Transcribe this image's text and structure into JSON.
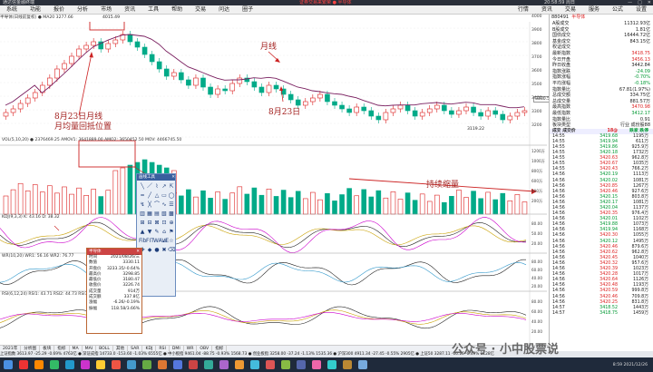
{
  "titlebar": {
    "left": "通达信金融终端",
    "center": "证券交易来繁荣 ● 半导体",
    "time": "20:58:59 周日"
  },
  "menu": [
    "系统",
    "功能",
    "报价",
    "分析",
    "市场",
    "资讯",
    "工具",
    "帮助",
    "交易",
    "问达",
    "圈子"
  ],
  "menu_right": [
    "行情",
    "资讯",
    "交易",
    "服务",
    "公式",
    "设置"
  ],
  "infobar": "半导体(日线前复权) ● MA20 3277.66",
  "kline_labels": {
    "top_price": "4015.49",
    "low_price": "3119.22",
    "right_scale": "3330.57"
  },
  "price_scale": [
    "4000",
    "3900",
    "3800",
    "3700",
    "3600",
    "3500",
    "3400",
    "3300",
    "3200",
    "3100"
  ],
  "annotations": {
    "month_line": "月线",
    "aug23_a": "8月23日月线",
    "aug23_b": "月均量回抵位置",
    "aug23_c": "8月23日",
    "shrink": "持续缩量"
  },
  "vol_label": "VOL(5,10,20) ● 2376469.25 AMOV1: 3641889.00 AMO2: 3650452.50 MOV: 4466745.50",
  "vol_scale": [
    "1200万",
    "1000万",
    "800万",
    "600万",
    "400万",
    "200万",
    "100万"
  ],
  "kdj_label": "KDJ(9,3,3) K: 43.16 D: 38.32",
  "kdj_scale": [
    "80.00",
    "50.00",
    "20.00"
  ],
  "wr_label": "WR(10,20) WR1: 56.16 WR2: 76.77",
  "wr_scale": [
    "80.00",
    "60.00",
    "40.00",
    "20.00"
  ],
  "rsi_label": "RSI(6,12,24) RSI1: 43.71 RSI2: 44.73 RSI3: 45.90",
  "rsi_scale": [
    "80.00",
    "60.00",
    "40.00",
    "20.00"
  ],
  "right_panel": {
    "code": "880491",
    "name": "半导体",
    "rows": [
      {
        "k": "A股成交",
        "v": "11312.93亿",
        "c": "blk"
      },
      {
        "k": "B股成交",
        "v": "1.81亿",
        "c": "blk"
      },
      {
        "k": "国债成交",
        "v": "16444.72亿",
        "c": "blk"
      },
      {
        "k": "基金成交",
        "v": "843.15亿",
        "c": "blk"
      },
      {
        "k": "权证成交",
        "v": "",
        "c": "blk"
      },
      {
        "k": "最新指数",
        "v": "3418.75",
        "c": "red"
      },
      {
        "k": "今日开盘",
        "v": "3456.13",
        "c": "red"
      },
      {
        "k": "昨日收盘",
        "v": "3442.84",
        "c": "blk"
      },
      {
        "k": "指数涨跌",
        "v": "-24.09",
        "c": "grn"
      },
      {
        "k": "指数涨幅",
        "v": "-0.70%",
        "c": "grn"
      },
      {
        "k": "平均涨幅",
        "v": "-0.18%",
        "c": "grn"
      },
      {
        "k": "指数量比",
        "v": "67.81(1.97%)",
        "c": "blk"
      },
      {
        "k": "总成交额",
        "v": "334.75亿",
        "c": "blk"
      },
      {
        "k": "总成交量",
        "v": "881.57万",
        "c": "blk"
      },
      {
        "k": "最高指数",
        "v": "3470.98",
        "c": "red"
      },
      {
        "k": "最低指数",
        "v": "3412.17",
        "c": "grn"
      },
      {
        "k": "指数量比",
        "v": "0.91",
        "c": "blk"
      },
      {
        "k": "板块类型",
        "v": "行业 成份股88",
        "c": "blk"
      }
    ],
    "tick_header": [
      "成交 成交价",
      "18@",
      "跌家 跌停",
      "68@"
    ],
    "ticks": [
      [
        "14:55",
        "3419.68",
        "1195万"
      ],
      [
        "14:55",
        "3419.94",
        "611万"
      ],
      [
        "14:55",
        "3419.86",
        "925.9万"
      ],
      [
        "14:55",
        "3420.18",
        "1732万"
      ],
      [
        "14:55",
        "3420.63",
        "962.8万"
      ],
      [
        "14:55",
        "3420.67",
        "1035万"
      ],
      [
        "14:55",
        "3420.43",
        "766.2万"
      ],
      [
        "14:56",
        "3420.19",
        "1113万"
      ],
      [
        "14:56",
        "3420.02",
        "1081万"
      ],
      [
        "14:56",
        "3420.85",
        "1267万"
      ],
      [
        "14:56",
        "3420.46",
        "927.6万"
      ],
      [
        "14:56",
        "3420.15",
        "803.8万"
      ],
      [
        "14:56",
        "3420.17",
        "1081万"
      ],
      [
        "14:56",
        "3420.04",
        "1137万"
      ],
      [
        "14:56",
        "3420.35",
        "976.4万"
      ],
      [
        "14:56",
        "3420.01",
        "1102万"
      ],
      [
        "14:56",
        "3419.88",
        "1073万"
      ],
      [
        "14:56",
        "3419.94",
        "1168万"
      ],
      [
        "14:56",
        "3420.30",
        "1055万"
      ],
      [
        "14:56",
        "3420.12",
        "1495万"
      ],
      [
        "14:56",
        "3420.46",
        "879.6万"
      ],
      [
        "14:56",
        "3420.62",
        "962.8万"
      ],
      [
        "14:56",
        "3420.45",
        "1040万"
      ],
      [
        "14:56",
        "3420.32",
        "957.6万"
      ],
      [
        "14:56",
        "3420.39",
        "1023万"
      ],
      [
        "14:56",
        "3420.28",
        "1017万"
      ],
      [
        "14:56",
        "3420.64",
        "1126万"
      ],
      [
        "14:56",
        "3420.48",
        "1193万"
      ],
      [
        "14:56",
        "3420.59",
        "999.8万"
      ],
      [
        "14:56",
        "3420.46",
        "709.8万"
      ],
      [
        "14:56",
        "3420.25",
        "831.8万"
      ],
      [
        "14:57",
        "3418.52",
        "1443万"
      ],
      [
        "14:57",
        "3418.75",
        "1459万"
      ]
    ]
  },
  "palette": {
    "title": "画线工具",
    "icons": [
      "╲",
      "／",
      "⌇",
      "↗",
      "⇱",
      "═",
      "╱",
      "△",
      "▭",
      "◯",
      "↯",
      "╳",
      "⌒",
      "∿",
      "☰",
      "▥",
      "▦",
      "▤",
      "▧",
      "▩",
      "⊞",
      "⊟",
      "⊠",
      "⊡",
      "⊕",
      "▲",
      "▼",
      "✎",
      "⌂",
      "⚑",
      "Fib",
      "FIT",
      "WAVE",
      "⊿",
      "☆",
      "✚",
      "◆",
      "●",
      "✖",
      "⌫"
    ]
  },
  "infowin": {
    "title": "半导体",
    "rows": [
      {
        "k": "时间",
        "v": "2021/08/26/三"
      },
      {
        "k": "数值",
        "v": "3330.11"
      },
      {
        "k": "开盘价",
        "v": "3233.35/-0.64%"
      },
      {
        "k": "最高价",
        "v": "3298.85"
      },
      {
        "k": "最低价",
        "v": "3180.47"
      },
      {
        "k": "收盘价",
        "v": "3226.74"
      },
      {
        "k": "成交量",
        "v": "914万"
      },
      {
        "k": "成交额",
        "v": "337.8亿"
      },
      {
        "k": "涨幅",
        "v": "-6.26/-0.19%"
      },
      {
        "k": "振幅",
        "v": "118.58/3.66%"
      }
    ]
  },
  "bottom_tabs": [
    "2021年",
    "分析图",
    "板块",
    "指标",
    "MA",
    "MAI",
    "BOLL",
    "其他",
    "SAR",
    "KDJ",
    "RSI",
    "DMI",
    "WR",
    "OBV",
    "指标"
  ],
  "status": "上证指数 3613.97 -25.29 -0.69% 4763亿 ● 深证成指 14733.0 -153.60 -1.03% 6555亿 ● 中小板指 9461.04 -88.75 -0.93% 1568.73 ● 创业板指 3258.00 -37.24 -1.13% 1535.36 ● 沪深300 4911.34 -27.45 -0.55% 2905亿 ● 上证50 3287.11 -16.16 -0.49% 1128亿",
  "watermark": "公众号 · 小中股票说",
  "taskbar_time": "8:59 2021/12/26"
}
